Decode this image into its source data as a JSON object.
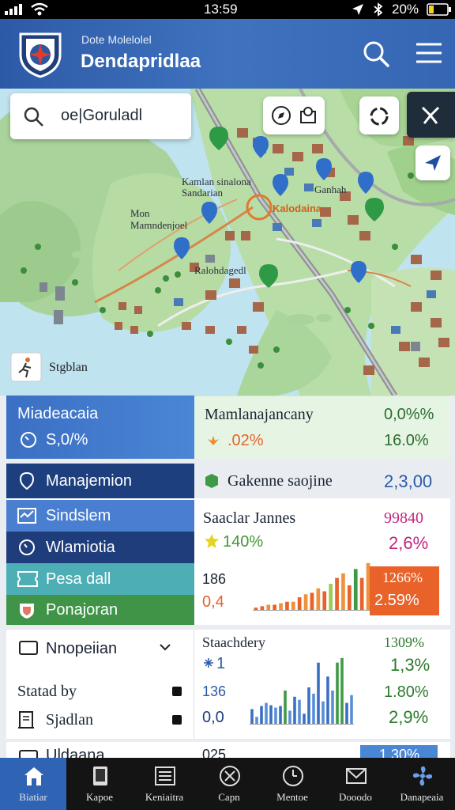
{
  "status_bar": {
    "time": "13:59",
    "battery": "20%"
  },
  "header": {
    "subtitle": "Dote Molelolel",
    "title": "Dendapridlaa"
  },
  "map": {
    "search_value": "oe|Goruladl",
    "labels": {
      "a": "Kamlan sinalona",
      "b": "Sandarian",
      "c": "Mon",
      "d": "Mamndenjoel",
      "e": "Kalodaina",
      "f": "Ganhah",
      "g": "Ralohdagedl",
      "h": "Stgblan"
    }
  },
  "panel1": {
    "left_title": "Miadeacaia",
    "left_value": "S,0/%",
    "right_title": "Mamlanajancany",
    "right_pct1": "0,0%%",
    "right_val2": ".02%",
    "right_pct2": "16.0%"
  },
  "panel2": {
    "menu_active": "Manajemion",
    "menu_items": [
      "Sindslem",
      "Wlamiotia",
      "Pesa dall",
      "Ponajoran"
    ],
    "gakenne_label": "Gakenne saojine",
    "gakenne_value": "2,3,00",
    "chart_title": "Saaclar Jannes",
    "chart_top_value": "99840",
    "stat_a": "140%",
    "stat_b": "2,6%",
    "axis_top": "186",
    "axis_bottom": "0,4",
    "badge1": "1266%",
    "badge2": "2.59%"
  },
  "panel3": {
    "dropdown": "Nnopeiian",
    "item1": "Statad by",
    "item2": "Sjadlan",
    "chart_title": "Staachdery",
    "val_small": "1",
    "val_136": "136",
    "val_00": "0,0",
    "pct_top": "1309%",
    "pct1": "1,3%",
    "pct2": "1.80%",
    "pct3": "2,9%"
  },
  "panel4": {
    "label": "Uldaana",
    "value": "025",
    "pct": "1,30%"
  },
  "chart_data": [
    {
      "type": "bar",
      "title": "Saaclar Jannes",
      "series": [
        {
          "values": [
            2,
            3,
            4,
            4,
            5,
            6,
            6,
            9,
            11,
            12,
            15,
            13,
            18,
            22,
            25,
            17,
            28,
            22,
            32
          ]
        }
      ]
    },
    {
      "type": "bar",
      "title": "Staachdery",
      "series": [
        {
          "values": [
            20,
            10,
            24,
            28,
            25,
            22,
            24,
            44,
            18,
            36,
            32,
            14,
            48,
            40,
            80,
            30,
            62,
            44,
            80,
            86,
            28,
            38
          ]
        }
      ]
    }
  ],
  "nav": {
    "items": [
      {
        "label": "Biatiar",
        "icon": "home-icon"
      },
      {
        "label": "Kapoe",
        "icon": "device-icon"
      },
      {
        "label": "Keniaitra",
        "icon": "list-icon"
      },
      {
        "label": "Capn",
        "icon": "tools-icon"
      },
      {
        "label": "Mentoe",
        "icon": "clock-icon"
      },
      {
        "label": "Dooodo",
        "icon": "mail-icon"
      },
      {
        "label": "Danapeaia",
        "icon": "fan-icon"
      }
    ]
  },
  "colors": {
    "header": "#3566b3",
    "accent_blue": "#3b6fc3",
    "accent_green": "#3f9a45",
    "accent_orange": "#e8622a",
    "nav_bg": "#141414"
  }
}
